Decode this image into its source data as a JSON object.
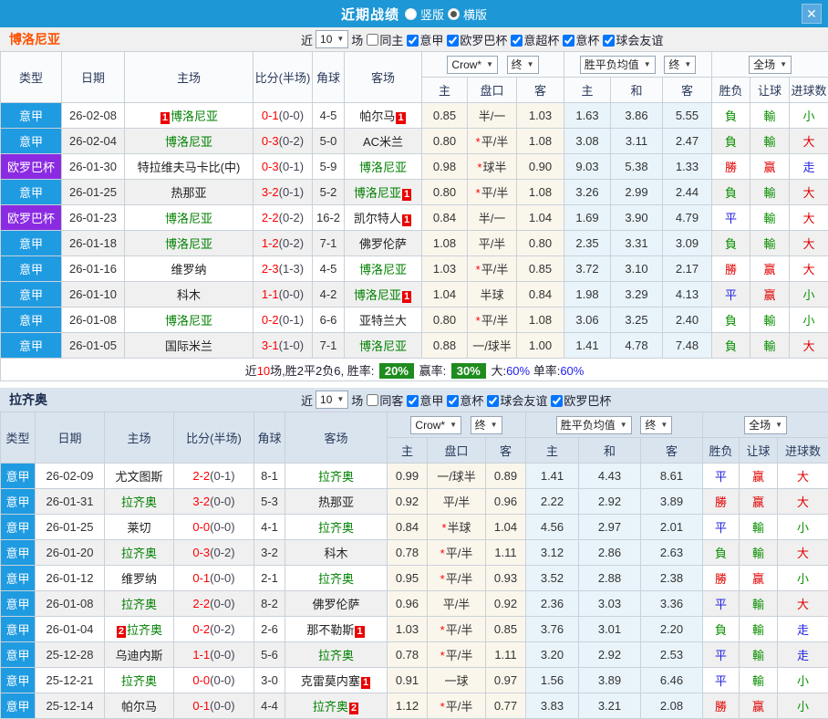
{
  "titlebar": {
    "title": "近期战绩",
    "radio_vertical": "竖版",
    "radio_horizontal": "横版",
    "selected": "横版",
    "close": "✕"
  },
  "colors": {
    "topbar_blue": "#1d97d5",
    "serie_a_blue": "#1f9be1",
    "europa_purple": "#8a2be2",
    "focus_team_green": "#008000",
    "score_red": "#ff0000",
    "badge_red": "#ea0000",
    "rate_badge_green": "#1e8c1e",
    "rate_blue": "#2222ee",
    "bologna_title": "#ff5100",
    "lazio_title": "#1b2b4d"
  },
  "sections": [
    {
      "team": "博洛尼亚",
      "filter": {
        "near": "近",
        "count": "10",
        "unit": "场",
        "same_label": "同主",
        "same_checked": false,
        "comps": [
          {
            "label": "意甲",
            "checked": true
          },
          {
            "label": "欧罗巴杯",
            "checked": true
          },
          {
            "label": "意超杯",
            "checked": true
          },
          {
            "label": "意杯",
            "checked": true
          },
          {
            "label": "球会友谊",
            "checked": true
          }
        ]
      },
      "header": {
        "type": "类型",
        "date": "日期",
        "home": "主场",
        "score": "比分(半场)",
        "corner": "角球",
        "away": "客场",
        "company": "Crow*",
        "final1": "终",
        "avg": "胜平负均值",
        "final2": "终",
        "scope": "全场",
        "sub_home": "主",
        "sub_hcap": "盘口",
        "sub_away": "客",
        "sub_home2": "主",
        "sub_draw": "和",
        "sub_away2": "客",
        "sub_result": "胜负",
        "sub_handicap": "让球",
        "sub_goals": "进球数"
      },
      "rows": [
        {
          "comp": "意甲",
          "date": "26-02-08",
          "home": "博洛尼亚",
          "home_badge": "1",
          "home_focus": true,
          "score": "0-1",
          "half": "(0-0)",
          "corner": "4-5",
          "away": "帕尔马",
          "away_badge": "1",
          "away_focus": false,
          "o1": "0.85",
          "star": false,
          "hcap": "半/一",
          "o2": "1.03",
          "a1": "1.63",
          "a2": "3.86",
          "a3": "5.55",
          "r1": "負",
          "r2": "輸",
          "r3": "小"
        },
        {
          "comp": "意甲",
          "date": "26-02-04",
          "home": "博洛尼亚",
          "home_badge": "",
          "home_focus": true,
          "score": "0-3",
          "half": "(0-2)",
          "corner": "5-0",
          "away": "AC米兰",
          "away_badge": "",
          "away_focus": false,
          "o1": "0.80",
          "star": true,
          "hcap": "平/半",
          "o2": "1.08",
          "a1": "3.08",
          "a2": "3.11",
          "a3": "2.47",
          "r1": "負",
          "r2": "輸",
          "r3": "大"
        },
        {
          "comp": "欧罗巴杯",
          "date": "26-01-30",
          "home": "特拉维夫马卡比(中)",
          "home_badge": "",
          "home_focus": false,
          "score": "0-3",
          "half": "(0-1)",
          "corner": "5-9",
          "away": "博洛尼亚",
          "away_badge": "",
          "away_focus": true,
          "o1": "0.98",
          "star": true,
          "hcap": "球半",
          "o2": "0.90",
          "a1": "9.03",
          "a2": "5.38",
          "a3": "1.33",
          "r1": "勝",
          "r2": "赢",
          "r3": "走"
        },
        {
          "comp": "意甲",
          "date": "26-01-25",
          "home": "热那亚",
          "home_badge": "",
          "home_focus": false,
          "score": "3-2",
          "half": "(0-1)",
          "corner": "5-2",
          "away": "博洛尼亚",
          "away_badge": "1",
          "away_focus": true,
          "o1": "0.80",
          "star": true,
          "hcap": "平/半",
          "o2": "1.08",
          "a1": "3.26",
          "a2": "2.99",
          "a3": "2.44",
          "r1": "負",
          "r2": "輸",
          "r3": "大"
        },
        {
          "comp": "欧罗巴杯",
          "date": "26-01-23",
          "home": "博洛尼亚",
          "home_badge": "",
          "home_focus": true,
          "score": "2-2",
          "half": "(0-2)",
          "corner": "16-2",
          "away": "凯尔特人",
          "away_badge": "1",
          "away_focus": false,
          "o1": "0.84",
          "star": false,
          "hcap": "半/一",
          "o2": "1.04",
          "a1": "1.69",
          "a2": "3.90",
          "a3": "4.79",
          "r1": "平",
          "r2": "輸",
          "r3": "大"
        },
        {
          "comp": "意甲",
          "date": "26-01-18",
          "home": "博洛尼亚",
          "home_badge": "",
          "home_focus": true,
          "score": "1-2",
          "half": "(0-2)",
          "corner": "7-1",
          "away": "佛罗伦萨",
          "away_badge": "",
          "away_focus": false,
          "o1": "1.08",
          "star": false,
          "hcap": "平/半",
          "o2": "0.80",
          "a1": "2.35",
          "a2": "3.31",
          "a3": "3.09",
          "r1": "負",
          "r2": "輸",
          "r3": "大"
        },
        {
          "comp": "意甲",
          "date": "26-01-16",
          "home": "维罗纳",
          "home_badge": "",
          "home_focus": false,
          "score": "2-3",
          "half": "(1-3)",
          "corner": "4-5",
          "away": "博洛尼亚",
          "away_badge": "",
          "away_focus": true,
          "o1": "1.03",
          "star": true,
          "hcap": "平/半",
          "o2": "0.85",
          "a1": "3.72",
          "a2": "3.10",
          "a3": "2.17",
          "r1": "勝",
          "r2": "赢",
          "r3": "大"
        },
        {
          "comp": "意甲",
          "date": "26-01-10",
          "home": "科木",
          "home_badge": "",
          "home_focus": false,
          "score": "1-1",
          "half": "(0-0)",
          "corner": "4-2",
          "away": "博洛尼亚",
          "away_badge": "1",
          "away_focus": true,
          "o1": "1.04",
          "star": false,
          "hcap": "半球",
          "o2": "0.84",
          "a1": "1.98",
          "a2": "3.29",
          "a3": "4.13",
          "r1": "平",
          "r2": "赢",
          "r3": "小"
        },
        {
          "comp": "意甲",
          "date": "26-01-08",
          "home": "博洛尼亚",
          "home_badge": "",
          "home_focus": true,
          "score": "0-2",
          "half": "(0-1)",
          "corner": "6-6",
          "away": "亚特兰大",
          "away_badge": "",
          "away_focus": false,
          "o1": "0.80",
          "star": true,
          "hcap": "平/半",
          "o2": "1.08",
          "a1": "3.06",
          "a2": "3.25",
          "a3": "2.40",
          "r1": "負",
          "r2": "輸",
          "r3": "小"
        },
        {
          "comp": "意甲",
          "date": "26-01-05",
          "home": "国际米兰",
          "home_badge": "",
          "home_focus": false,
          "score": "3-1",
          "half": "(1-0)",
          "corner": "7-1",
          "away": "博洛尼亚",
          "away_badge": "",
          "away_focus": true,
          "o1": "0.88",
          "star": false,
          "hcap": "一/球半",
          "o2": "1.00",
          "a1": "1.41",
          "a2": "4.78",
          "a3": "7.48",
          "r1": "負",
          "r2": "輸",
          "r3": "大"
        }
      ],
      "summary": {
        "pre": "近",
        "num": "10",
        "mid": "场,胜2平2负6, 胜率:",
        "rate1": "20%",
        "lbl2": "赢率:",
        "rate2": "30%",
        "lbl3": "大:",
        "rate3": "60%",
        "lbl4": "单率:",
        "rate4": "60%"
      }
    },
    {
      "team": "拉齐奥",
      "filter": {
        "near": "近",
        "count": "10",
        "unit": "场",
        "same_label": "同客",
        "same_checked": false,
        "comps": [
          {
            "label": "意甲",
            "checked": true
          },
          {
            "label": "意杯",
            "checked": true
          },
          {
            "label": "球会友谊",
            "checked": true
          },
          {
            "label": "欧罗巴杯",
            "checked": true
          }
        ]
      },
      "header": {
        "type": "类型",
        "date": "日期",
        "home": "主场",
        "score": "比分(半场)",
        "corner": "角球",
        "away": "客场",
        "company": "Crow*",
        "final1": "终",
        "avg": "胜平负均值",
        "final2": "终",
        "scope": "全场",
        "sub_home": "主",
        "sub_hcap": "盘口",
        "sub_away": "客",
        "sub_home2": "主",
        "sub_draw": "和",
        "sub_away2": "客",
        "sub_result": "胜负",
        "sub_handicap": "让球",
        "sub_goals": "进球数"
      },
      "rows": [
        {
          "comp": "意甲",
          "date": "26-02-09",
          "home": "尤文图斯",
          "home_badge": "",
          "home_focus": false,
          "score": "2-2",
          "half": "(0-1)",
          "corner": "8-1",
          "away": "拉齐奥",
          "away_badge": "",
          "away_focus": true,
          "o1": "0.99",
          "star": false,
          "hcap": "一/球半",
          "o2": "0.89",
          "a1": "1.41",
          "a2": "4.43",
          "a3": "8.61",
          "r1": "平",
          "r2": "赢",
          "r3": "大"
        },
        {
          "comp": "意甲",
          "date": "26-01-31",
          "home": "拉齐奥",
          "home_badge": "",
          "home_focus": true,
          "score": "3-2",
          "half": "(0-0)",
          "corner": "5-3",
          "away": "热那亚",
          "away_badge": "",
          "away_focus": false,
          "o1": "0.92",
          "star": false,
          "hcap": "平/半",
          "o2": "0.96",
          "a1": "2.22",
          "a2": "2.92",
          "a3": "3.89",
          "r1": "勝",
          "r2": "赢",
          "r3": "大"
        },
        {
          "comp": "意甲",
          "date": "26-01-25",
          "home": "莱切",
          "home_badge": "",
          "home_focus": false,
          "score": "0-0",
          "half": "(0-0)",
          "corner": "4-1",
          "away": "拉齐奥",
          "away_badge": "",
          "away_focus": true,
          "o1": "0.84",
          "star": true,
          "hcap": "半球",
          "o2": "1.04",
          "a1": "4.56",
          "a2": "2.97",
          "a3": "2.01",
          "r1": "平",
          "r2": "輸",
          "r3": "小"
        },
        {
          "comp": "意甲",
          "date": "26-01-20",
          "home": "拉齐奥",
          "home_badge": "",
          "home_focus": true,
          "score": "0-3",
          "half": "(0-2)",
          "corner": "3-2",
          "away": "科木",
          "away_badge": "",
          "away_focus": false,
          "o1": "0.78",
          "star": true,
          "hcap": "平/半",
          "o2": "1.11",
          "a1": "3.12",
          "a2": "2.86",
          "a3": "2.63",
          "r1": "負",
          "r2": "輸",
          "r3": "大"
        },
        {
          "comp": "意甲",
          "date": "26-01-12",
          "home": "维罗纳",
          "home_badge": "",
          "home_focus": false,
          "score": "0-1",
          "half": "(0-0)",
          "corner": "2-1",
          "away": "拉齐奥",
          "away_badge": "",
          "away_focus": true,
          "o1": "0.95",
          "star": true,
          "hcap": "平/半",
          "o2": "0.93",
          "a1": "3.52",
          "a2": "2.88",
          "a3": "2.38",
          "r1": "勝",
          "r2": "赢",
          "r3": "小"
        },
        {
          "comp": "意甲",
          "date": "26-01-08",
          "home": "拉齐奥",
          "home_badge": "",
          "home_focus": true,
          "score": "2-2",
          "half": "(0-0)",
          "corner": "8-2",
          "away": "佛罗伦萨",
          "away_badge": "",
          "away_focus": false,
          "o1": "0.96",
          "star": false,
          "hcap": "平/半",
          "o2": "0.92",
          "a1": "2.36",
          "a2": "3.03",
          "a3": "3.36",
          "r1": "平",
          "r2": "輸",
          "r3": "大"
        },
        {
          "comp": "意甲",
          "date": "26-01-04",
          "home": "拉齐奥",
          "home_badge": "2",
          "home_focus": true,
          "score": "0-2",
          "half": "(0-2)",
          "corner": "2-6",
          "away": "那不勒斯",
          "away_badge": "1",
          "away_focus": false,
          "o1": "1.03",
          "star": true,
          "hcap": "平/半",
          "o2": "0.85",
          "a1": "3.76",
          "a2": "3.01",
          "a3": "2.20",
          "r1": "負",
          "r2": "輸",
          "r3": "走"
        },
        {
          "comp": "意甲",
          "date": "25-12-28",
          "home": "乌迪内斯",
          "home_badge": "",
          "home_focus": false,
          "score": "1-1",
          "half": "(0-0)",
          "corner": "5-6",
          "away": "拉齐奥",
          "away_badge": "",
          "away_focus": true,
          "o1": "0.78",
          "star": true,
          "hcap": "平/半",
          "o2": "1.11",
          "a1": "3.20",
          "a2": "2.92",
          "a3": "2.53",
          "r1": "平",
          "r2": "輸",
          "r3": "走"
        },
        {
          "comp": "意甲",
          "date": "25-12-21",
          "home": "拉齐奥",
          "home_badge": "",
          "home_focus": true,
          "score": "0-0",
          "half": "(0-0)",
          "corner": "3-0",
          "away": "克雷莫内塞",
          "away_badge": "1",
          "away_focus": false,
          "o1": "0.91",
          "star": false,
          "hcap": "一球",
          "o2": "0.97",
          "a1": "1.56",
          "a2": "3.89",
          "a3": "6.46",
          "r1": "平",
          "r2": "輸",
          "r3": "小"
        },
        {
          "comp": "意甲",
          "date": "25-12-14",
          "home": "帕尔马",
          "home_badge": "",
          "home_focus": false,
          "score": "0-1",
          "half": "(0-0)",
          "corner": "4-4",
          "away": "拉齐奥",
          "away_badge": "2",
          "away_focus": true,
          "o1": "1.12",
          "star": true,
          "hcap": "平/半",
          "o2": "0.77",
          "a1": "3.83",
          "a2": "3.21",
          "a3": "2.08",
          "r1": "勝",
          "r2": "赢",
          "r3": "小"
        }
      ],
      "summary": null
    }
  ]
}
